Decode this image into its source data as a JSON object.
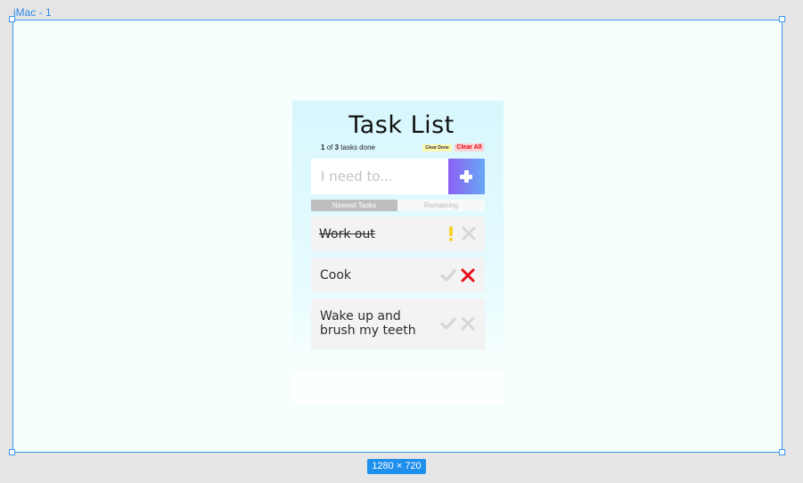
{
  "canvas": {
    "frame_label": "iMac - 1",
    "size_badge": "1280 × 720"
  },
  "app": {
    "title": "Task List",
    "status": {
      "done": "1",
      "of": "of",
      "total": "3",
      "suffix": "tasks done"
    },
    "clear_done_label": "Clear Done",
    "clear_all_label": "Clear All",
    "input": {
      "placeholder": "I need to...",
      "value": ""
    },
    "tabs": [
      {
        "label": "Newest Tasks",
        "active": true
      },
      {
        "label": "Remaining",
        "active": false
      }
    ],
    "tasks": [
      {
        "text": "Work out",
        "done": true
      },
      {
        "text": "Cook",
        "done": false
      },
      {
        "text": "Wake up and brush my teeth",
        "done": false
      }
    ]
  },
  "colors": {
    "frame_border": "#3b99f2",
    "clear_done_bg": "#fbf9b0",
    "clear_all_bg": "#fcd2d2",
    "clear_all_text": "#e8000e",
    "add_button_gradient_start": "#8d5ff4",
    "add_button_gradient_end": "#68a8f5",
    "done_indicator": "#f5d130",
    "delete_active": "#e8111b",
    "icon_inactive": "#d6d6d6"
  },
  "icons": {
    "add": "plus-icon",
    "done_marker": "exclamation-icon",
    "complete": "check-icon",
    "delete": "close-icon"
  }
}
